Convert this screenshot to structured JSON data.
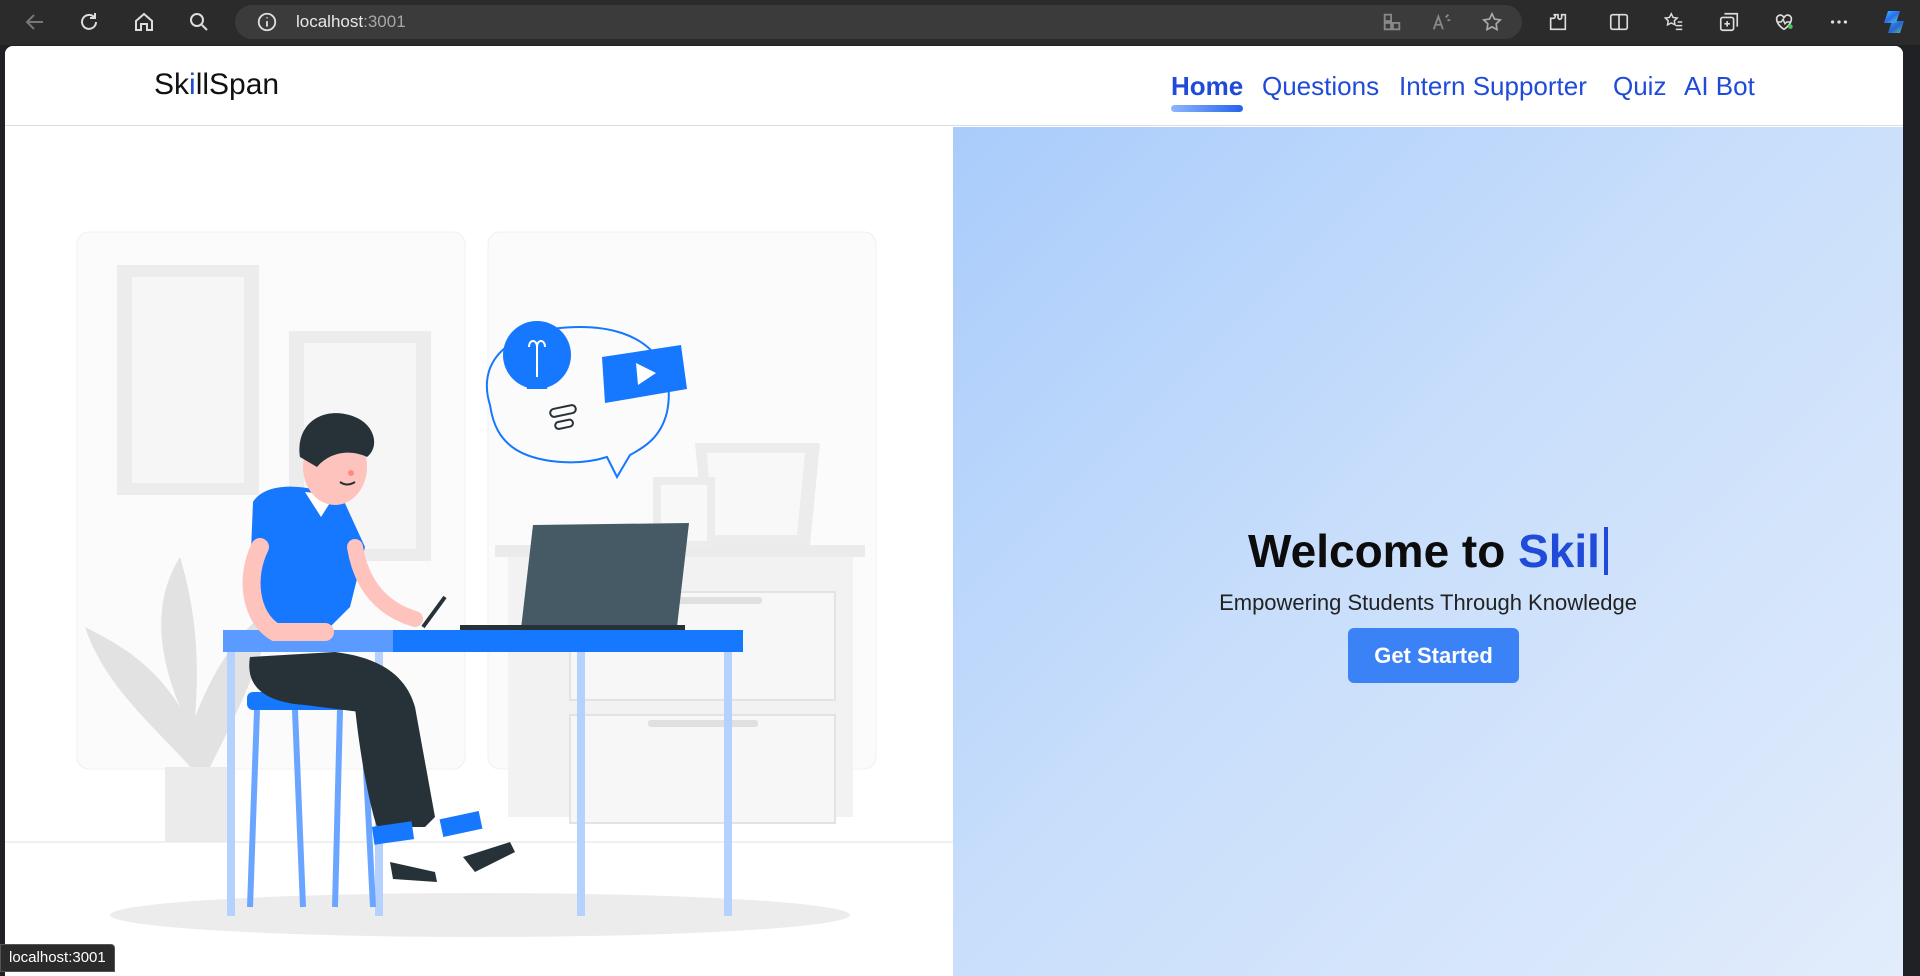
{
  "browser": {
    "url_host": "localhost",
    "url_port": ":3001",
    "status_url": "localhost:3001",
    "icons": [
      "back-icon",
      "refresh-icon",
      "home-icon",
      "search-icon",
      "info-icon",
      "apps-icon",
      "read-aloud-icon",
      "favorite-star-icon",
      "extensions-icon",
      "split-screen-icon",
      "favorites-icon",
      "collections-icon",
      "health-icon",
      "more-icon",
      "copilot-icon"
    ]
  },
  "site": {
    "brand_prefix": "Sk",
    "brand_i": "i",
    "brand_suffix": "llSpan",
    "nav": {
      "home": "Home",
      "questions": "Questions",
      "intern_supporter": "Intern Supporter",
      "quiz": "Quiz",
      "ai_bot": "AI Bot"
    }
  },
  "hero": {
    "welcome_prefix": "Welcome to ",
    "welcome_typed": "Skil",
    "tagline": "Empowering Students Through Knowledge",
    "cta_label": "Get Started"
  },
  "colors": {
    "accent": "#1f4bd8",
    "button": "#3b82f6",
    "illustration_blue": "#1677ff",
    "hero_gradient_start": "#a9ccfb",
    "hero_gradient_end": "#e2ecfb"
  }
}
